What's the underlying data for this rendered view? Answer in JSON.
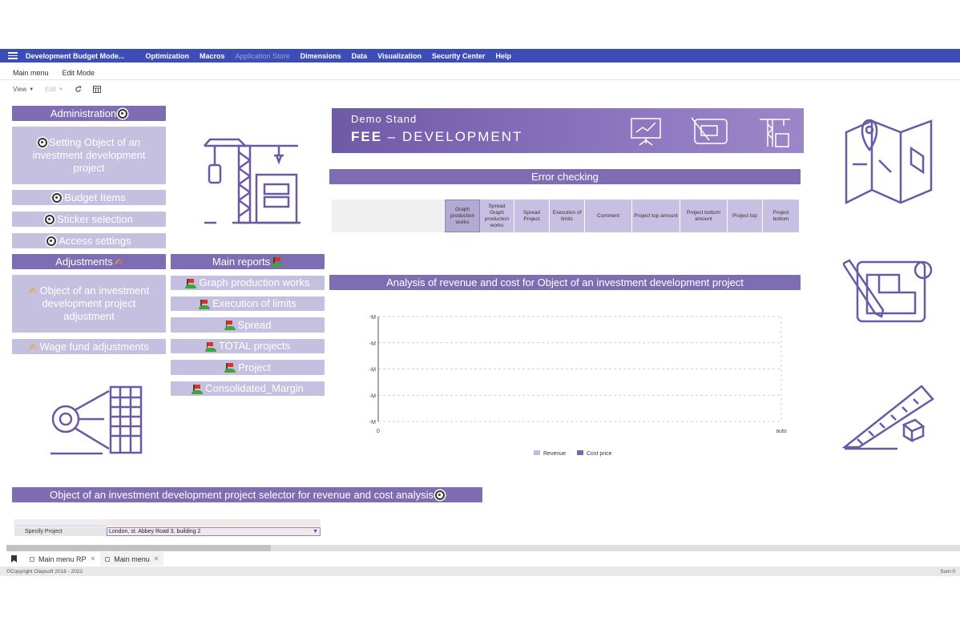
{
  "menubar": {
    "app_title": "Development Budget Mode...",
    "items": [
      "Optimization",
      "Macros",
      "Application Store",
      "Dimensions",
      "Data",
      "Visualization",
      "Security Center",
      "Help"
    ]
  },
  "submenu": {
    "main_menu": "Main menu",
    "edit_mode": "Edit Mode"
  },
  "toolbar": {
    "view": "View",
    "edit": "Edit"
  },
  "left": {
    "administration": "Administration",
    "setting_object": "Setting Object of an investment development project",
    "budget_items": "Budget Items",
    "sticker_selection": "Sticker selection",
    "access_settings": "Access settings",
    "adjustments": "Adjustments",
    "object_adjustment": "Object of an investment development project adjustment",
    "wage_fund": "Wage fund adjustments"
  },
  "reports": {
    "header": "Main reports",
    "graph": "Graph production works",
    "execution": "Execution of limits",
    "spread": "Spread",
    "total": "TOTAL projects",
    "project": "Project",
    "consolidated": "Consolidated_Margin"
  },
  "banner": {
    "demo": "Demo Stand",
    "fee_bold": "FEE",
    "fee_rest": " – DEVELOPMENT"
  },
  "error_checking": {
    "title": "Error checking",
    "columns": [
      "Graph production works",
      "Spread Graph production works",
      "Spread Project",
      "Execution of limits",
      "Comment",
      "Project top amount",
      "Project bottom amount",
      "Project top",
      "Project bottom"
    ]
  },
  "analysis_title": "Analysis of revenue and cost for Object of an investment development project",
  "chart_data": {
    "type": "bar",
    "x_ticks": [
      "0",
      "auto"
    ],
    "y_ticks": [
      "-M",
      "-M",
      "-M",
      "-M",
      "-M"
    ],
    "series": [
      {
        "name": "Revenue",
        "values": [],
        "color": "#c3bbdf"
      },
      {
        "name": "Cost price",
        "values": [],
        "color": "#7a67b0"
      }
    ],
    "grid": true,
    "legend": "bottom"
  },
  "selector": {
    "title": "Object of an investment development project selector for revenue and cost analysis",
    "label": "Specify Project",
    "value": "London, st. Abbey Road 3, building 2"
  },
  "tabs": [
    {
      "label": "Main menu RP"
    },
    {
      "label": "Main menu"
    }
  ],
  "footer": {
    "copyright": "©Copyright Olapsoft 2018 - 2022",
    "sum": "Sum:0"
  },
  "colors": {
    "menubar": "#3d4db7",
    "header": "#7e6db3",
    "button": "#c5bfe0",
    "illustration": "#6a5aa6"
  }
}
